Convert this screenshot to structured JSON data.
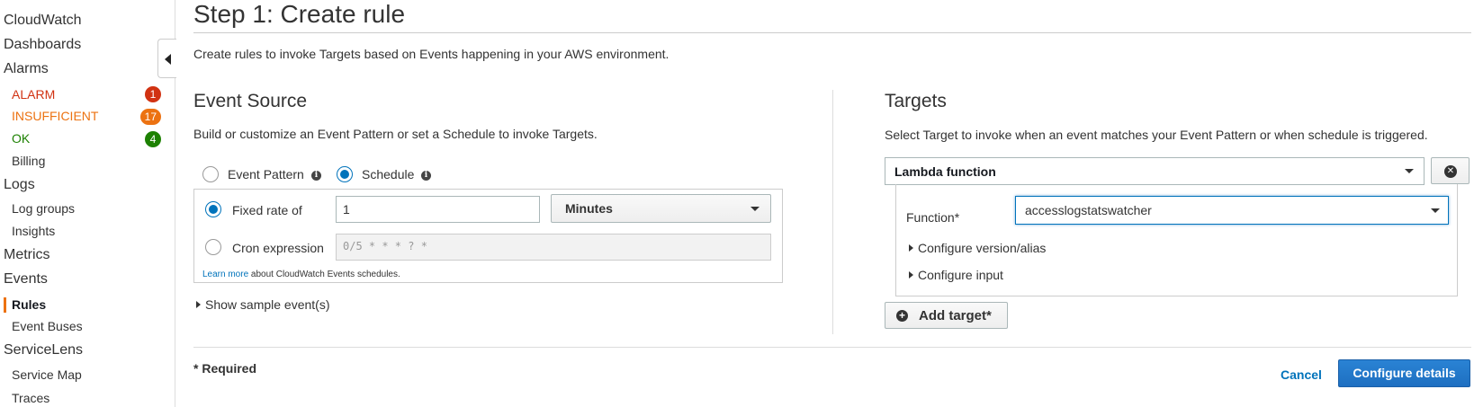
{
  "sidebar": {
    "cloudwatch": "CloudWatch",
    "dashboards": "Dashboards",
    "alarms": "Alarms",
    "alarm": {
      "label": "ALARM",
      "count": "1"
    },
    "insufficient": {
      "label": "INSUFFICIENT",
      "count": "17"
    },
    "ok": {
      "label": "OK",
      "count": "4"
    },
    "billing": "Billing",
    "logs": "Logs",
    "log_groups": "Log groups",
    "insights": "Insights",
    "metrics": "Metrics",
    "events": "Events",
    "rules": "Rules",
    "event_buses": "Event Buses",
    "servicelens": "ServiceLens",
    "service_map": "Service Map",
    "traces": "Traces"
  },
  "page": {
    "title": "Step 1: Create rule",
    "intro": "Create rules to invoke Targets based on Events happening in your AWS environment."
  },
  "event_source": {
    "heading": "Event Source",
    "desc": "Build or customize an Event Pattern or set a Schedule to invoke Targets.",
    "event_pattern_label": "Event Pattern",
    "schedule_label": "Schedule",
    "fixed_rate_label": "Fixed rate of",
    "fixed_rate_value": "1",
    "unit": "Minutes",
    "cron_label": "Cron expression",
    "cron_placeholder": "0/5 * * * ? *",
    "learn_more": "Learn more",
    "learn_more_rest": " about CloudWatch Events schedules.",
    "show_sample": "Show sample event(s)"
  },
  "targets": {
    "heading": "Targets",
    "desc": "Select Target to invoke when an event matches your Event Pattern or when schedule is triggered.",
    "target_type": "Lambda function",
    "function_label": "Function*",
    "function_value": "accesslogstatswatcher",
    "configure_version": "Configure version/alias",
    "configure_input": "Configure input",
    "add_target": "Add target*"
  },
  "footer": {
    "required": "* Required",
    "cancel": "Cancel",
    "configure_details": "Configure details"
  },
  "colors": {
    "accent": "#0073bb",
    "alarm": "#d13212",
    "insufficient": "#ec7211",
    "ok": "#1d8102"
  }
}
